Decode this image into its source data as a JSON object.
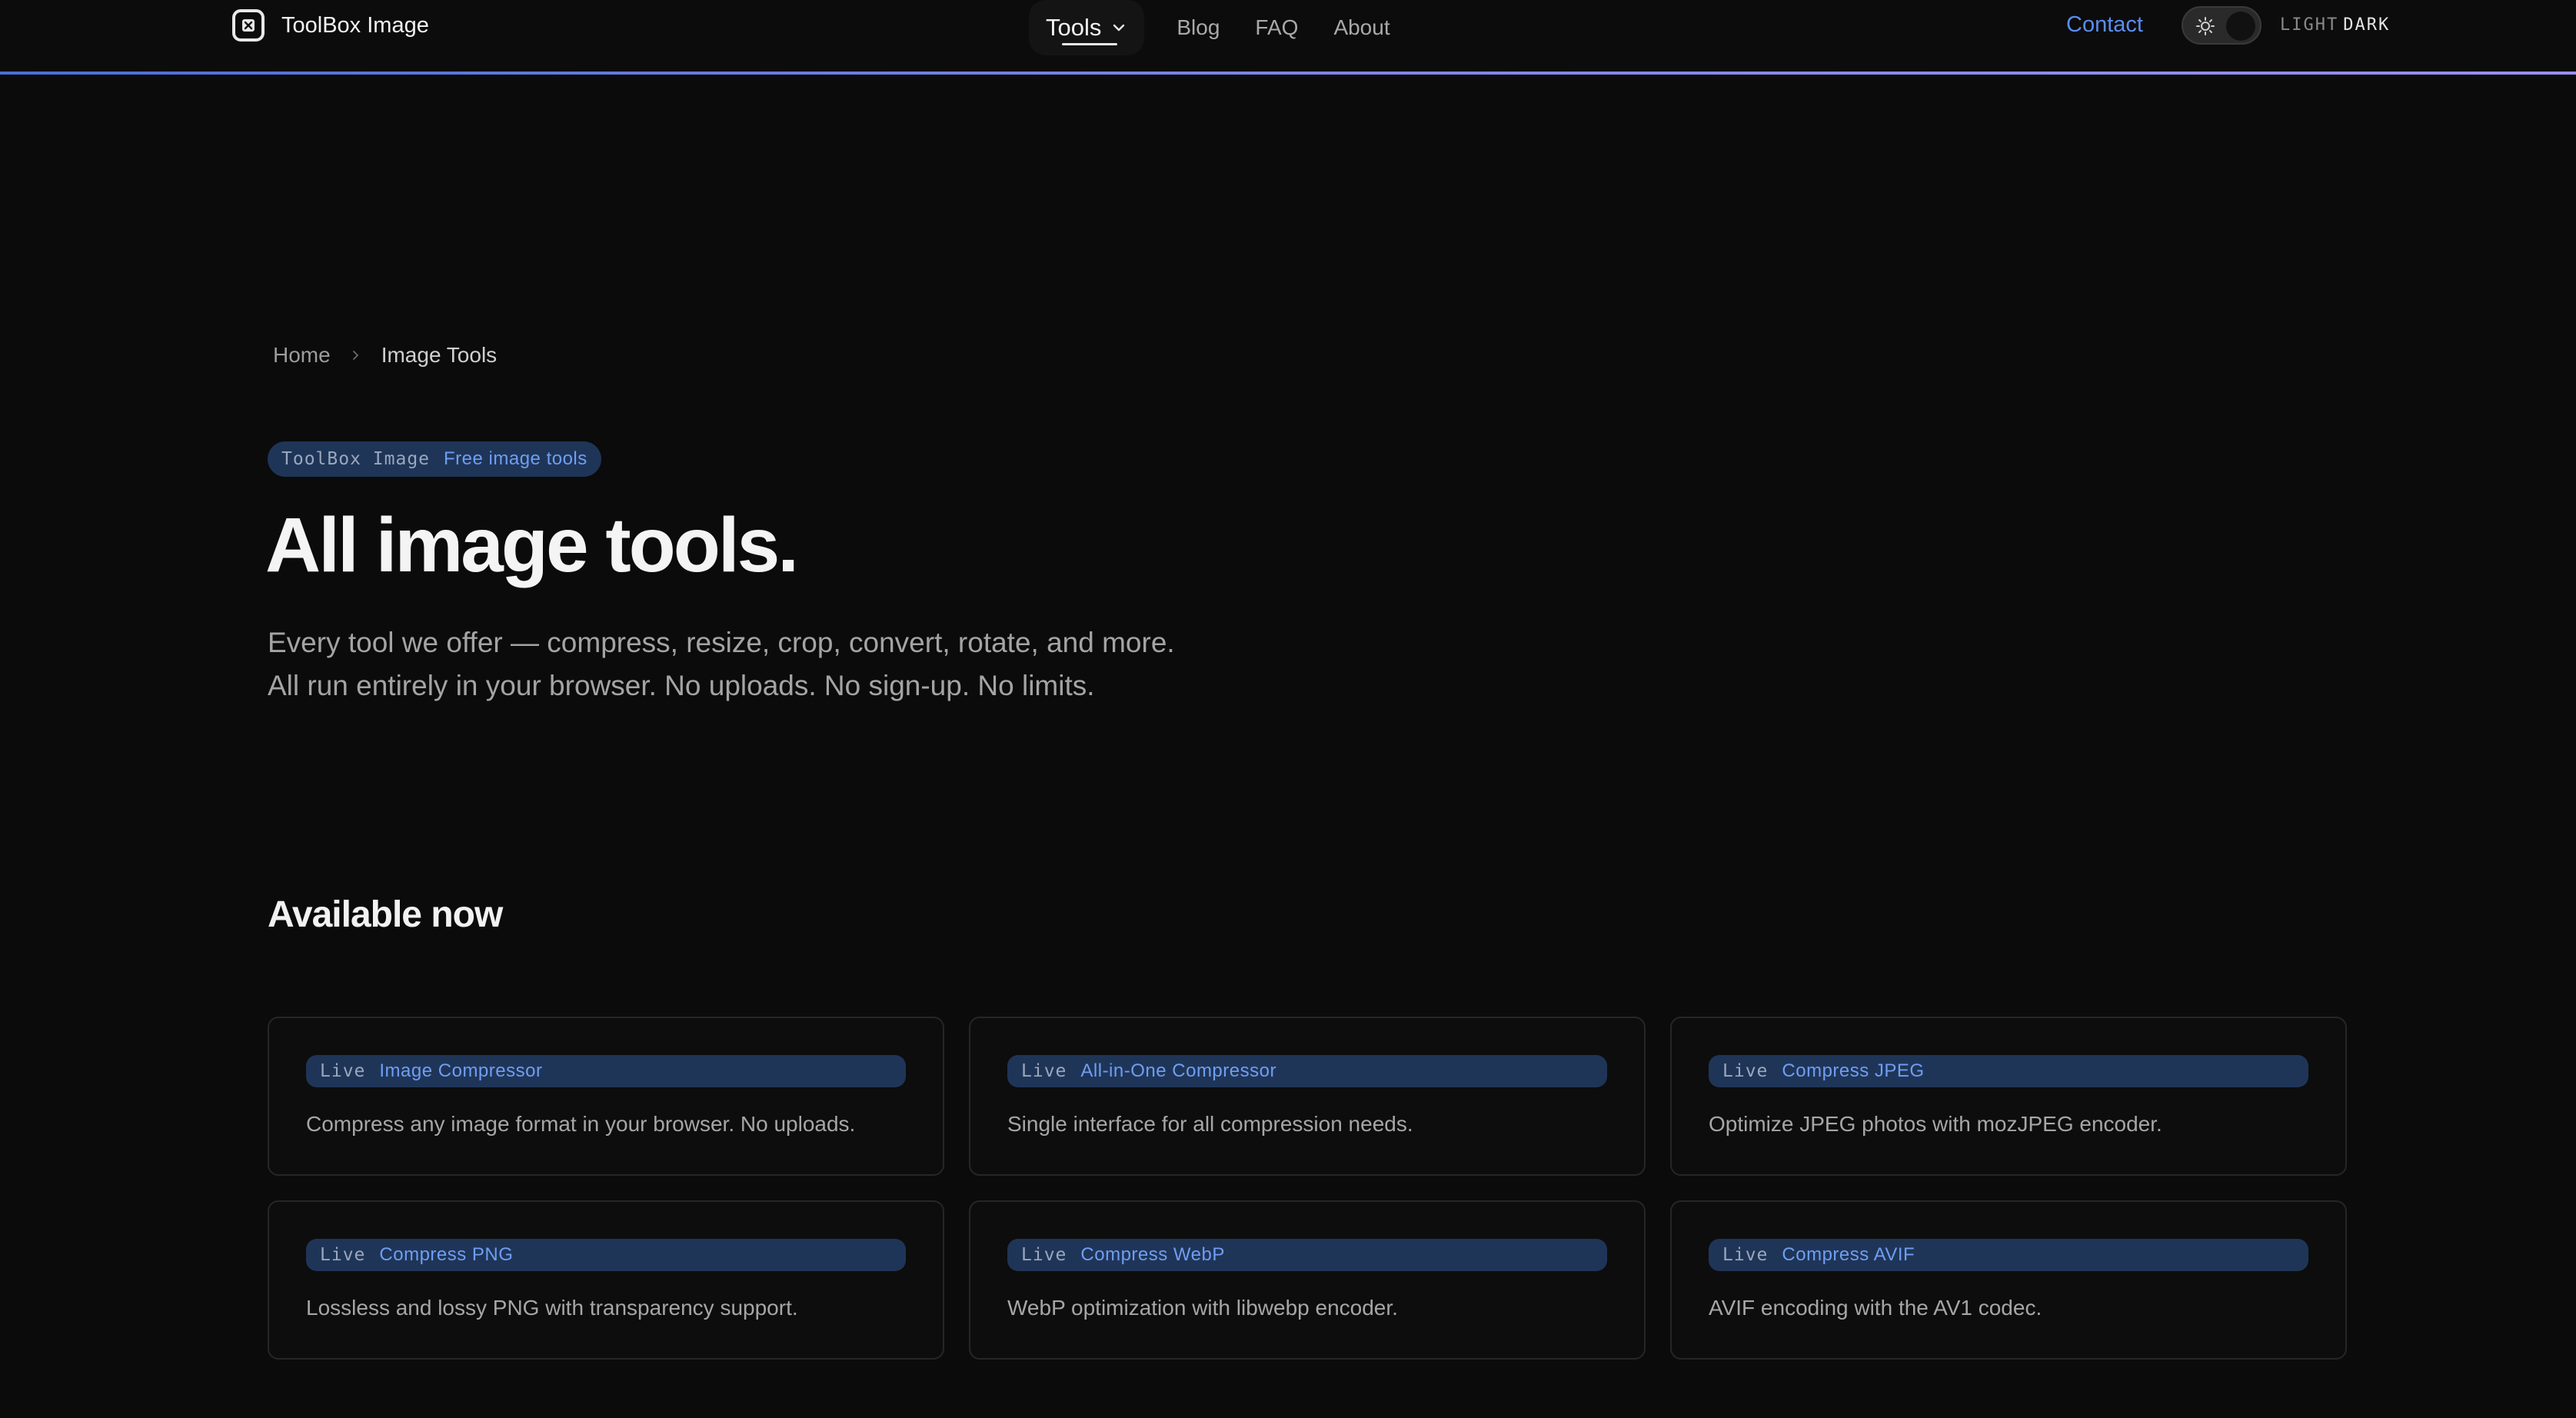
{
  "header": {
    "brand": "ToolBox Image",
    "nav": {
      "tools_label": "Tools",
      "links": [
        "Blog",
        "FAQ",
        "About"
      ]
    },
    "contact_label": "Contact",
    "theme": {
      "light_label": "LIGHT",
      "dark_label": "DARK",
      "active": "dark"
    }
  },
  "breadcrumb": {
    "home": "Home",
    "current": "Image Tools"
  },
  "hero": {
    "pill_mono": "ToolBox Image",
    "pill_accent": "Free image tools",
    "title": "All image tools.",
    "lede_line1": "Every tool we offer — compress, resize, crop, convert, rotate, and more.",
    "lede_line2": "All run entirely in your browser. No uploads. No sign-up. No limits."
  },
  "section": {
    "title": "Available now",
    "tools": [
      {
        "status": "Live",
        "name": "Image Compressor",
        "desc": "Compress any image format in your browser. No uploads."
      },
      {
        "status": "Live",
        "name": "All-in-One Compressor",
        "desc": "Single interface for all compression needs."
      },
      {
        "status": "Live",
        "name": "Compress JPEG",
        "desc": "Optimize JPEG photos with mozJPEG encoder."
      },
      {
        "status": "Live",
        "name": "Compress PNG",
        "desc": "Lossless and lossy PNG with transparency support."
      },
      {
        "status": "Live",
        "name": "Compress WebP",
        "desc": "WebP optimization with libwebp encoder."
      },
      {
        "status": "Live",
        "name": "Compress AVIF",
        "desc": "AVIF encoding with the AV1 codec."
      }
    ]
  },
  "colors": {
    "accent": "#5b8def",
    "tag_bg": "#1f3558",
    "background": "#0b0b0b"
  },
  "icons": {
    "logo": "toolbox-logo-icon",
    "chevron": "chevron-down-icon",
    "separator": "chevron-right-icon",
    "theme": "sun-icon"
  }
}
